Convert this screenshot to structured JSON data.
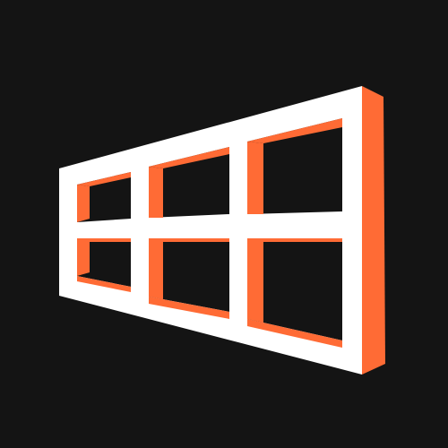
{
  "logo": {
    "icon": "window-frame-icon",
    "colors": {
      "background": "#141414",
      "frame": "#ffffff",
      "accent": "#ff6b35"
    }
  }
}
